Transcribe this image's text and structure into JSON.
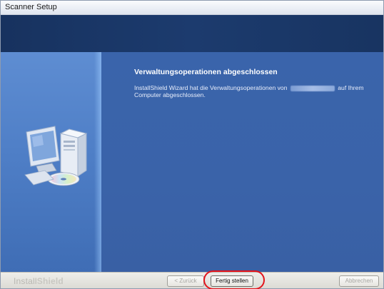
{
  "window": {
    "title": "Scanner Setup"
  },
  "content": {
    "heading": "Verwaltungsoperationen abgeschlossen",
    "message_before": "InstallShield Wizard hat die Verwaltungsoperationen von",
    "message_after": "auf Ihrem Computer abgeschlossen."
  },
  "footer": {
    "brand_part1": "Install",
    "brand_part2": "Shield",
    "back_label": "< Zurück",
    "finish_label": "Fertig stellen",
    "cancel_label": "Abbrechen"
  },
  "colors": {
    "header_band": "#1c3b6e",
    "panel_blue": "#3e67ad",
    "highlight": "#e3141c"
  },
  "icons": {
    "illustration": "computer-with-cd-icon"
  }
}
